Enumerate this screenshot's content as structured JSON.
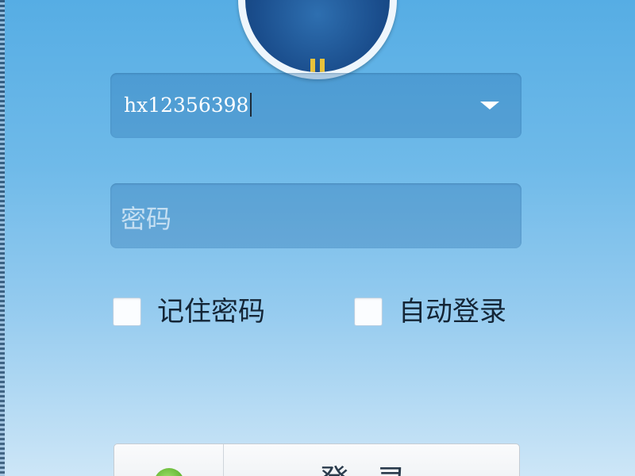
{
  "login": {
    "username": {
      "value": "hx12356398",
      "dropdown_icon": "chevron-down-icon"
    },
    "password": {
      "placeholder": "密码"
    },
    "options": {
      "remember_password": {
        "label": "记住密码",
        "checked": false
      },
      "auto_login": {
        "label": "自动登录",
        "checked": false
      }
    },
    "submit": {
      "label": "登录",
      "icon": "status-icon"
    }
  },
  "colors": {
    "background_top": "#56ade4",
    "background_bottom": "#cde6f7",
    "field_fill": "#266eaa",
    "text_dark": "#142536"
  }
}
